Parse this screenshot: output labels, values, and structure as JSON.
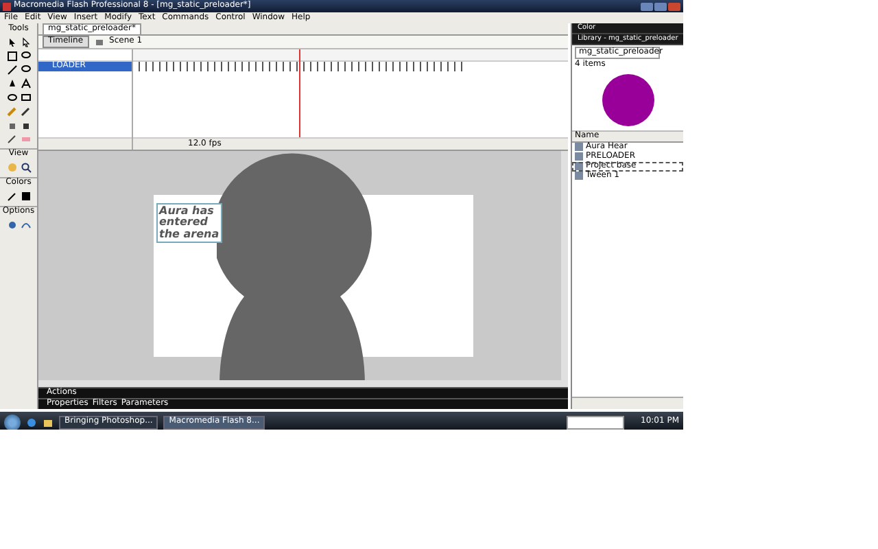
{
  "window": {
    "title": "Macromedia Flash Professional 8 - [mg_static_preloader*]"
  },
  "menu": [
    "File",
    "Edit",
    "View",
    "Insert",
    "Modify",
    "Text",
    "Commands",
    "Control",
    "Window",
    "Help"
  ],
  "tools": {
    "title": "Tools",
    "sections": [
      "View",
      "Colors",
      "Options"
    ]
  },
  "document_tab": {
    "label": "mg_static_preloader*"
  },
  "timeline": {
    "button": "Timeline",
    "scene": "Scene 1",
    "layers": [
      {
        "name": "LOADER",
        "selected": true
      }
    ],
    "fps": "12.0 fps"
  },
  "stage": {
    "text_lines": [
      "Aura has",
      "entered",
      "the arena"
    ]
  },
  "panels": {
    "color_panel": "Color",
    "library_title": "Library - mg_static_preloader",
    "library_select": "mg_static_preloader",
    "count": "4 items",
    "column": "Name",
    "items": [
      {
        "name": "Aura Hear",
        "selected": false
      },
      {
        "name": "PRELOADER",
        "selected": false
      },
      {
        "name": "Project base",
        "selected": true
      },
      {
        "name": "Tween 1",
        "selected": false
      }
    ]
  },
  "bottom_panels": [
    "Actions"
  ],
  "bottom_tabs": [
    "Properties",
    "Filters",
    "Parameters"
  ],
  "taskbar": {
    "windows": [
      {
        "label": "Bringing Photoshop...",
        "selected": false
      },
      {
        "label": "Macromedia Flash 8...",
        "selected": true
      }
    ],
    "clock": "10:01 PM"
  }
}
